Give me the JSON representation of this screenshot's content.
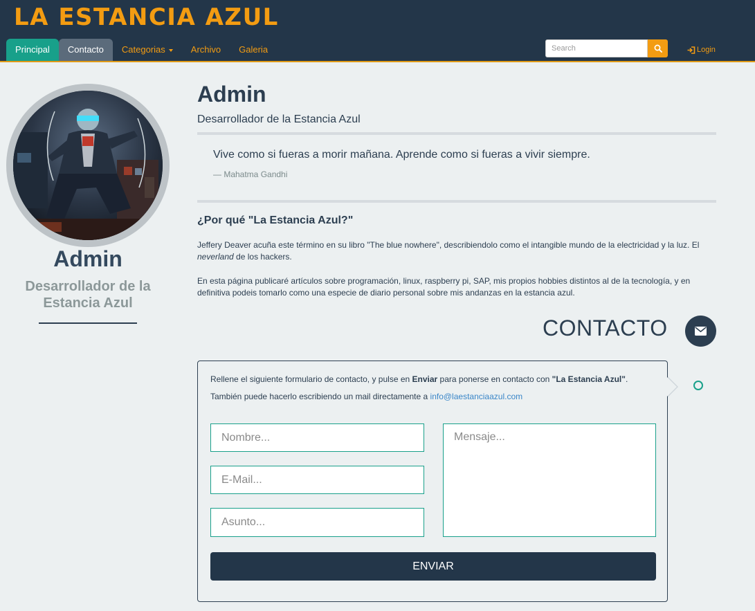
{
  "header": {
    "brand": "LA ESTANCIA AZUL",
    "nav": [
      {
        "label": "Principal"
      },
      {
        "label": "Contacto"
      },
      {
        "label": "Categorias"
      },
      {
        "label": "Archivo"
      },
      {
        "label": "Galeria"
      }
    ],
    "search_placeholder": "Search",
    "login_label": "Login",
    "colors": {
      "background": "#233649",
      "accent": "#f39c12",
      "active_tab": "#18a08a"
    }
  },
  "sidebar": {
    "avatar_icon": "avatar-photo",
    "name": "Admin",
    "role": "Desarrollador de la Estancia Azul"
  },
  "profile": {
    "title": "Admin",
    "subtitle": "Desarrollador de la Estancia Azul",
    "quote": "Vive como si fueras a morir mañana. Aprende como si fueras a vivir siempre.",
    "quote_author": "— Mahatma Gandhi",
    "why_title": "¿Por qué \"La Estancia Azul?\"",
    "para1_a": "Jeffery Deaver acuña este término en su libro \"The blue nowhere\", describiendolo como el intangible mundo de la electricidad y la luz. El ",
    "para1_em": "neverland",
    "para1_b": " de los hackers.",
    "para2": "En esta página publicaré artículos sobre programación, linux, raspberry pi, SAP, mis propios hobbies distintos al de la tecnología, y en definitiva podeis tomarlo como una especie de diario personal sobre mis andanzas en la estancia azul."
  },
  "contact": {
    "heading": "CONTACTO",
    "icon": "envelope-icon",
    "line1_a": "Rellene el siguiente formulario de contacto, y pulse en ",
    "line1_b": "Enviar",
    "line1_c": " para ponerse en contacto con ",
    "line1_d": "\"La Estancia Azul\"",
    "line1_e": ".",
    "line2_a": "También puede hacerlo escribiendo un mail directamente a ",
    "email": "info@laestanciaazul.com",
    "name_placeholder": "Nombre...",
    "email_placeholder": "E-Mail...",
    "subject_placeholder": "Asunto...",
    "message_placeholder": "Mensaje...",
    "send_label": "ENVIAR"
  }
}
